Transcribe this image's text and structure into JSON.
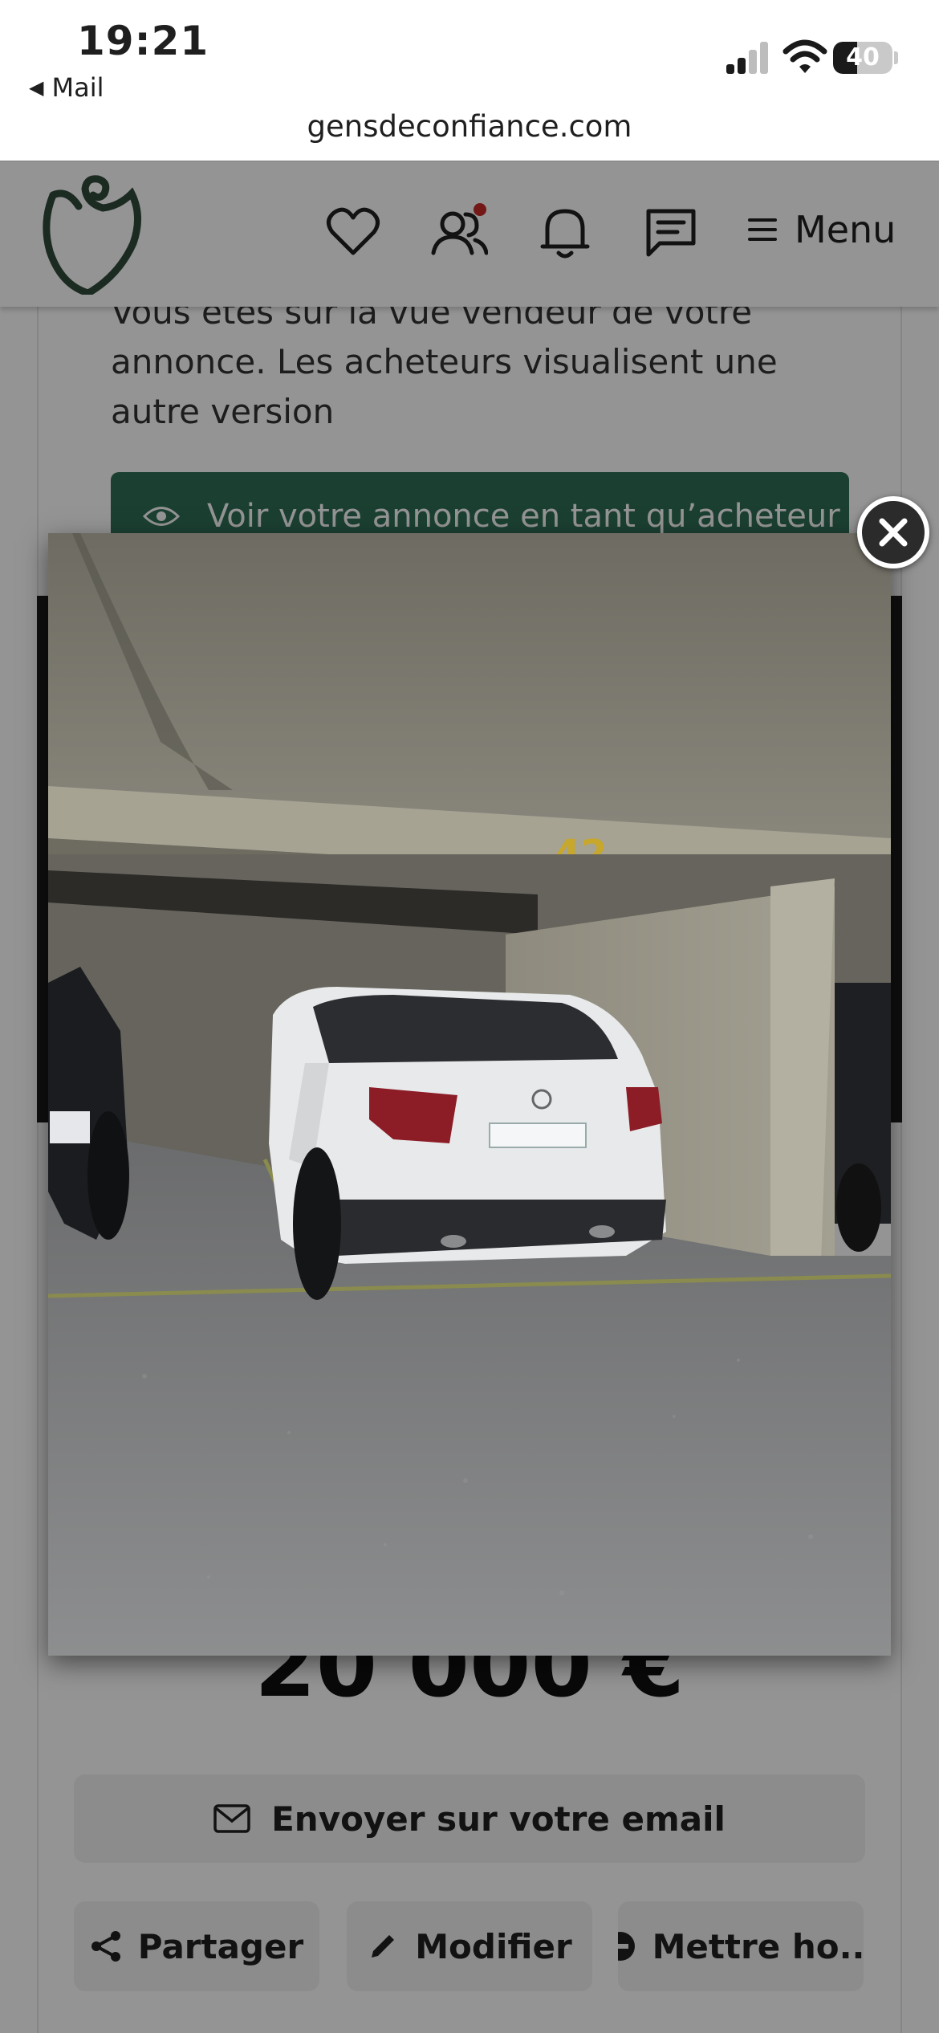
{
  "status_bar": {
    "time": "19:21",
    "back_label": "Mail",
    "battery_level": "40",
    "url": "gensdeconfiance.com"
  },
  "header": {
    "menu_label": "Menu",
    "icons": [
      "logo-icon",
      "heart-icon",
      "users-icon",
      "bell-icon",
      "chat-icon",
      "hamburger-icon"
    ],
    "brand_color": "#2f4a3c",
    "notification_dot_color": "#c62828"
  },
  "listing": {
    "seller_note": "Vous êtes sur la vue vendeur de votre annonce. Les acheteurs visualisent une autre version",
    "buyer_view_label": "Voir votre annonce en tant qu’acheteur",
    "price": "20 000 €",
    "email_label": "Envoyer sur votre email",
    "actions": {
      "share_label": "Partager",
      "edit_label": "Modifier",
      "unpublish_label": "Mettre ho..."
    },
    "accent_color": "#2f6f57"
  },
  "lightbox": {
    "image_icon": "parking-space-photo",
    "close_icon": "close-icon"
  }
}
